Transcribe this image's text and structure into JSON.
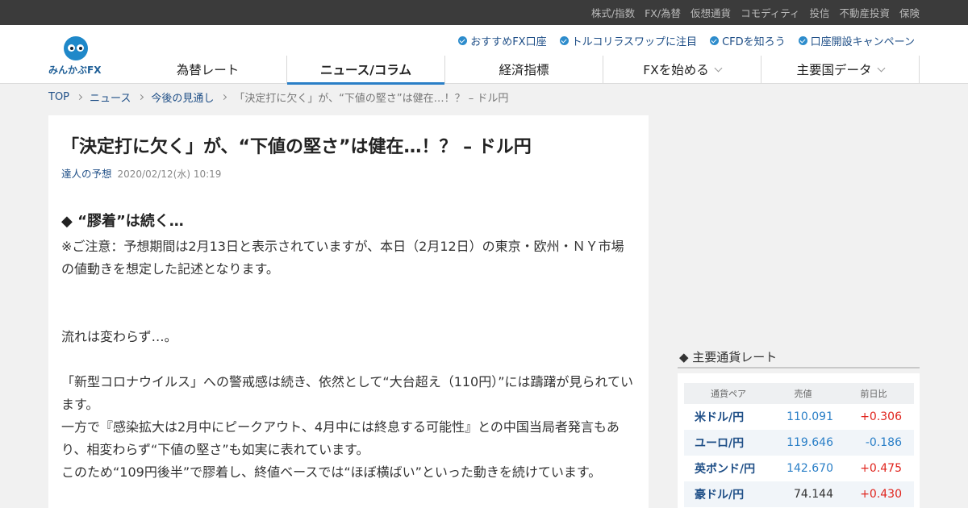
{
  "topbar": {
    "links": [
      "株式/指数",
      "FX/為替",
      "仮想通貨",
      "コモディティ",
      "投信",
      "不動産投資",
      "保険"
    ]
  },
  "logo": {
    "text": "みんかぶFX"
  },
  "promo": [
    "おすすめFX口座",
    "トルコリラスワップに注目",
    "CFDを知ろう",
    "口座開設キャンペーン"
  ],
  "gnav": [
    {
      "label": "為替レート"
    },
    {
      "label": "ニュース/コラム"
    },
    {
      "label": "経済指標"
    },
    {
      "label": "FXを始める"
    },
    {
      "label": "主要国データ"
    }
  ],
  "breadcrumb": {
    "items": [
      "TOP",
      "ニュース",
      "今後の見通し"
    ],
    "current": "「決定打に欠く」が、“下値の堅さ”は健在…！？ – ドル円"
  },
  "article": {
    "title": "「決定打に欠く」が、“下値の堅さ”は健在…！？ – ドル円",
    "category": "達人の予想",
    "date": "2020/02/12(水) 10:19",
    "section_head": "◆ “膠着”は続く…",
    "paragraphs": [
      "※ご注意：予想期間は2月13日と表示されていますが、本日（2月12日）の東京・欧州・ＮＹ市場の値動きを想定した記述となります。",
      "",
      "",
      "流れは変わらず…。",
      "",
      "「新型コロナウイルス」への警戒感は続き、依然として“大台超え（110円）”には躊躇が見られています。",
      "一方で『感染拡大は2月中にピークアウト、4月中には終息する可能性』との中国当局者発言もあり、相変わらず“下値の堅さ”も如実に表れています。",
      "このため“109円後半”で膠着し、終値ベースでは“ほぼ横ばい”といった動きを続けています。"
    ]
  },
  "rates": {
    "heading": "◆ 主要通貨レート",
    "columns": [
      "通貨ペア",
      "売値",
      "前日比"
    ],
    "rows": [
      {
        "pair": "米ドル/円",
        "bid": "110.091",
        "change": "+0.306"
      },
      {
        "pair": "ユーロ/円",
        "bid": "119.646",
        "change": "-0.186"
      },
      {
        "pair": "英ポンド/円",
        "bid": "142.670",
        "change": "+0.475"
      },
      {
        "pair": "豪ドル/円",
        "bid": "74.144",
        "change": "+0.430"
      }
    ],
    "colors": {
      "up": "#e0241d",
      "down": "#2a7fc7"
    }
  }
}
